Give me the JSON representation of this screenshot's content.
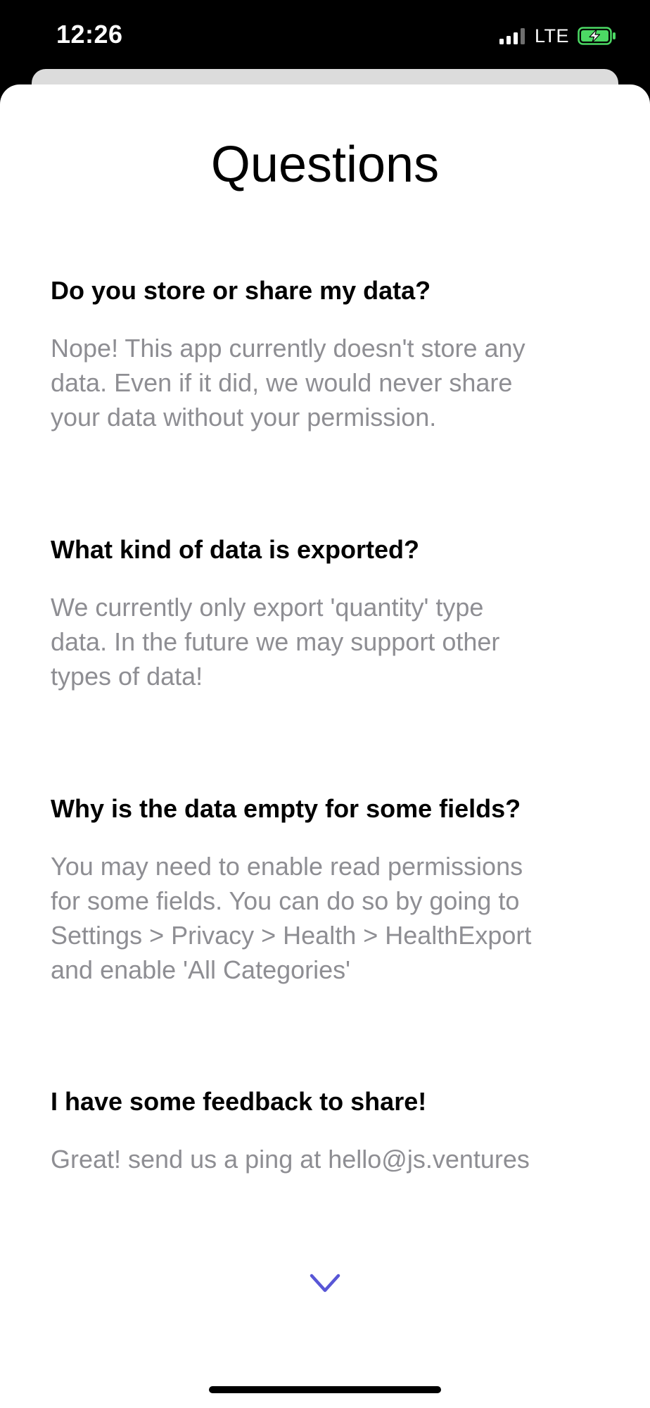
{
  "status_bar": {
    "time": "12:26",
    "network": "LTE",
    "signal_bars_active": 3,
    "signal_bars_total": 4,
    "battery_charging": true,
    "battery_color": "#4cd964"
  },
  "page": {
    "title": "Questions"
  },
  "faq": [
    {
      "question": "Do you store or share my data?",
      "answer_lines": [
        "Nope! This app currently doesn't store any",
        "data. Even if it did, we would never share",
        "your data without your permission."
      ]
    },
    {
      "question": "What kind of data is exported?",
      "answer_lines": [
        "We currently only export 'quantity' type",
        "data. In the future we may support other",
        "types of data!"
      ]
    },
    {
      "question": "Why is the data empty for some fields?",
      "answer_lines": [
        "You may need to enable read permissions",
        "for some fields. You can do so by going to",
        "Settings > Privacy > Health > HealthExport",
        "and enable 'All Categories'"
      ]
    },
    {
      "question": "I have some feedback to share!",
      "answer_lines": [
        "Great! send us a ping at hello@js.ventures"
      ]
    }
  ],
  "scroll_indicator": {
    "icon": "chevron-down-icon",
    "color": "#5856d6"
  }
}
